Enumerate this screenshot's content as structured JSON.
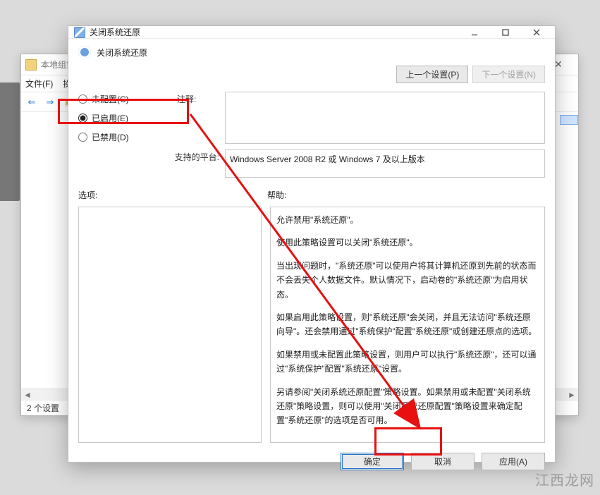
{
  "background_window": {
    "title": "本地组策",
    "menu": {
      "file": "文件(F)",
      "more": "操"
    },
    "status": "2 个设置"
  },
  "dialog": {
    "window_title": "关闭系统还原",
    "header": "关闭系统还原",
    "nav": {
      "prev": "上一个设置(P)",
      "next": "下一个设置(N)"
    },
    "radios": {
      "unconfigured": "未配置(C)",
      "enabled": "已启用(E)",
      "disabled": "已禁用(D)"
    },
    "comment_label": "注释:",
    "platform_label": "支持的平台:",
    "platform_text": "Windows Server 2008 R2 或 Windows 7 及以上版本",
    "options_label": "选项:",
    "help_label": "帮助:",
    "help_paragraphs": [
      "允许禁用\"系统还原\"。",
      "使用此策略设置可以关闭\"系统还原\"。",
      "当出现问题时，\"系统还原\"可以使用户将其计算机还原到先前的状态而不会丢失个人数据文件。默认情况下，启动卷的\"系统还原\"为启用状态。",
      "如果启用此策略设置，则\"系统还原\"会关闭，并且无法访问\"系统还原向导\"。还会禁用通过\"系统保护\"配置\"系统还原\"或创建还原点的选项。",
      "如果禁用或未配置此策略设置，则用户可以执行\"系统还原\"，还可以通过\"系统保护\"配置\"系统还原\"设置。",
      "另请参阅\"关闭系统还原配置\"策略设置。如果禁用或未配置\"关闭系统还原\"策略设置，则可以使用\"关闭系统还原配置\"策略设置来确定配置\"系统还原\"的选项是否可用。"
    ],
    "buttons": {
      "ok": "确定",
      "cancel": "取消",
      "apply": "应用(A)"
    }
  },
  "watermark": "江西龙网"
}
